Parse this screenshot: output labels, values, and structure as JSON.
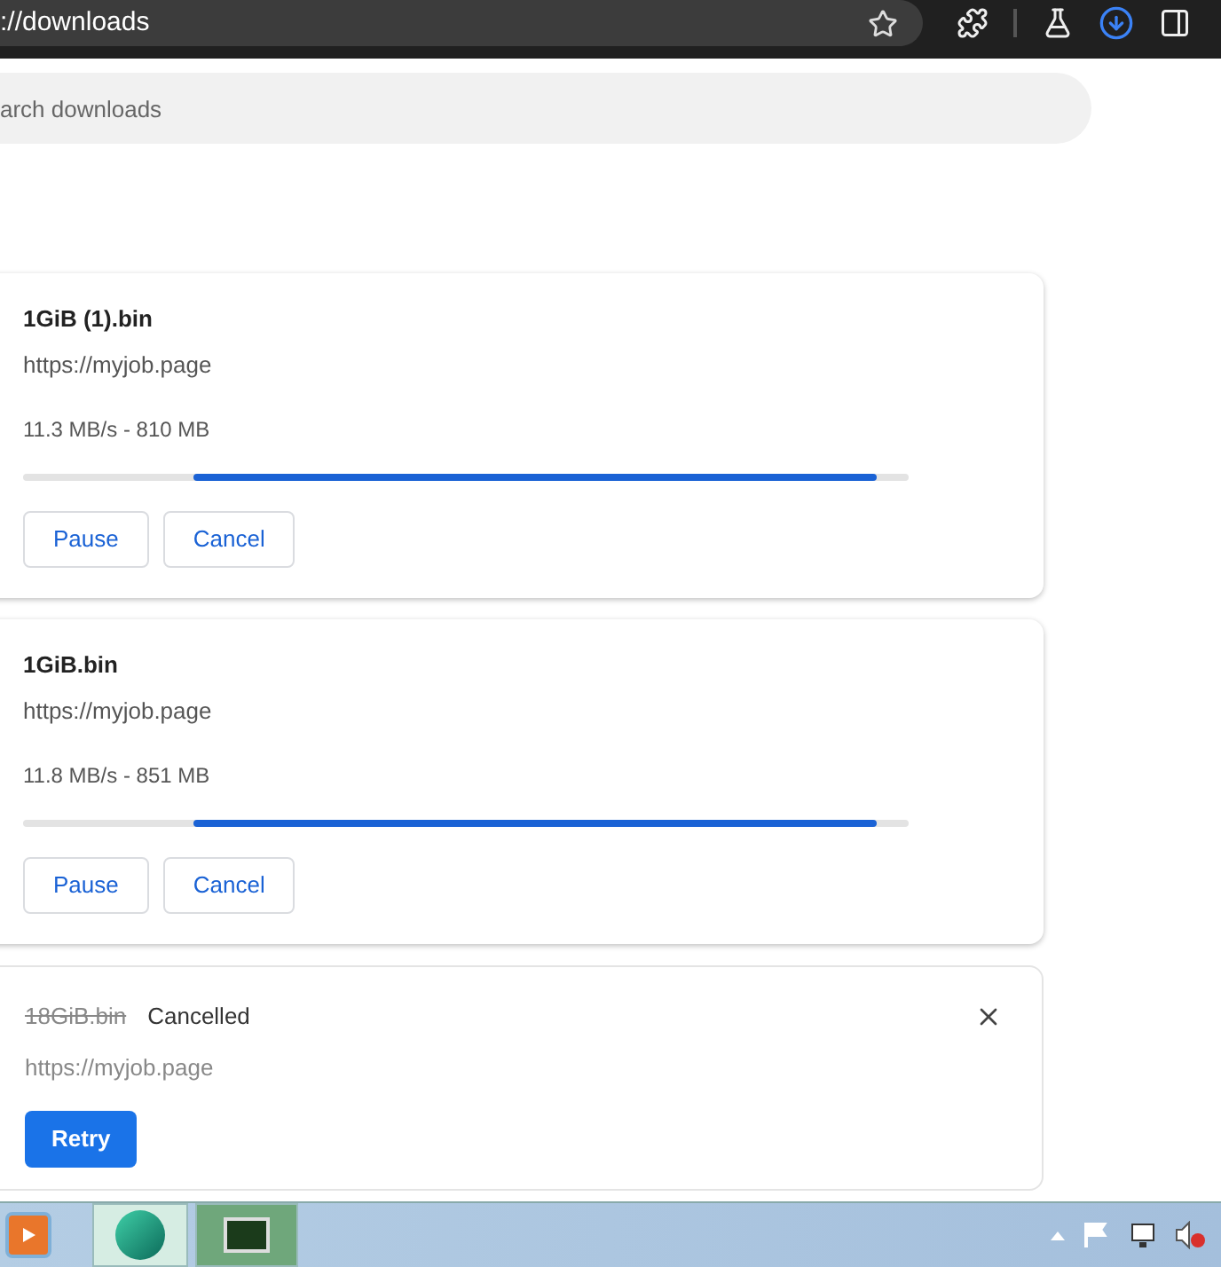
{
  "address_bar": {
    "url": "://downloads"
  },
  "search": {
    "placeholder": "arch downloads"
  },
  "downloads": [
    {
      "kind": "active",
      "filename": "1GiB (1).bin",
      "url": "https://myjob.page",
      "status": "11.3 MB/s - 810 MB",
      "progress": {
        "kind": "indeterminate"
      },
      "buttons": [
        "Pause",
        "Cancel"
      ]
    },
    {
      "kind": "active",
      "filename": "1GiB.bin",
      "url": "https://myjob.page",
      "status": "11.8 MB/s - 851 MB",
      "progress": {
        "kind": "indeterminate"
      },
      "buttons": [
        "Pause",
        "Cancel"
      ]
    },
    {
      "kind": "cancelled",
      "filename": "18GiB.bin",
      "state_label": "Cancelled",
      "url": "https://myjob.page",
      "buttons": [
        "Retry"
      ]
    }
  ]
}
